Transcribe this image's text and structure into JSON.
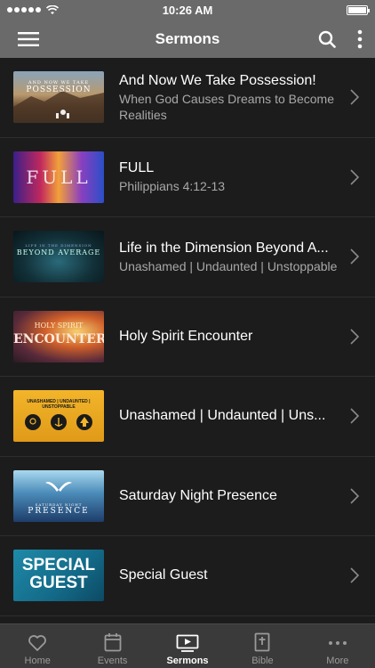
{
  "status": {
    "time": "10:26 AM"
  },
  "nav": {
    "title": "Sermons"
  },
  "sermons": [
    {
      "title": "And Now We Take Possession!",
      "subtitle": "When God Causes Dreams to Become Realities",
      "thumb_text": "POSSESSION",
      "thumb_caption": "AND NOW WE TAKE"
    },
    {
      "title": "FULL",
      "subtitle": "Philippians 4:12-13",
      "thumb_text": "FULL"
    },
    {
      "title": "Life in the Dimension Beyond A...",
      "subtitle": "Unashamed | Undaunted | Unstoppable",
      "thumb_text": "BEYOND AVERAGE",
      "thumb_caption": "LIFE IN THE DIMENSION"
    },
    {
      "title": "Holy Spirit Encounter",
      "subtitle": "",
      "thumb_text": "ENCOUNTER",
      "thumb_caption": "HOLY SPIRIT"
    },
    {
      "title": "Unashamed | Undaunted | Uns...",
      "subtitle": "",
      "thumb_caption": "UNASHAMED | UNDAUNTED | UNSTOPPABLE"
    },
    {
      "title": "Saturday Night Presence",
      "subtitle": "",
      "thumb_text": "PRESENCE",
      "thumb_caption": "SATURDAY NIGHT"
    },
    {
      "title": "Special Guest",
      "subtitle": "",
      "thumb_text": "SPECIAL",
      "thumb_caption": "GUEST"
    }
  ],
  "tabs": [
    {
      "label": "Home",
      "icon": "heart-icon"
    },
    {
      "label": "Events",
      "icon": "calendar-icon"
    },
    {
      "label": "Sermons",
      "icon": "play-screen-icon"
    },
    {
      "label": "Bible",
      "icon": "bible-icon"
    },
    {
      "label": "More",
      "icon": "more-dots-icon"
    }
  ]
}
